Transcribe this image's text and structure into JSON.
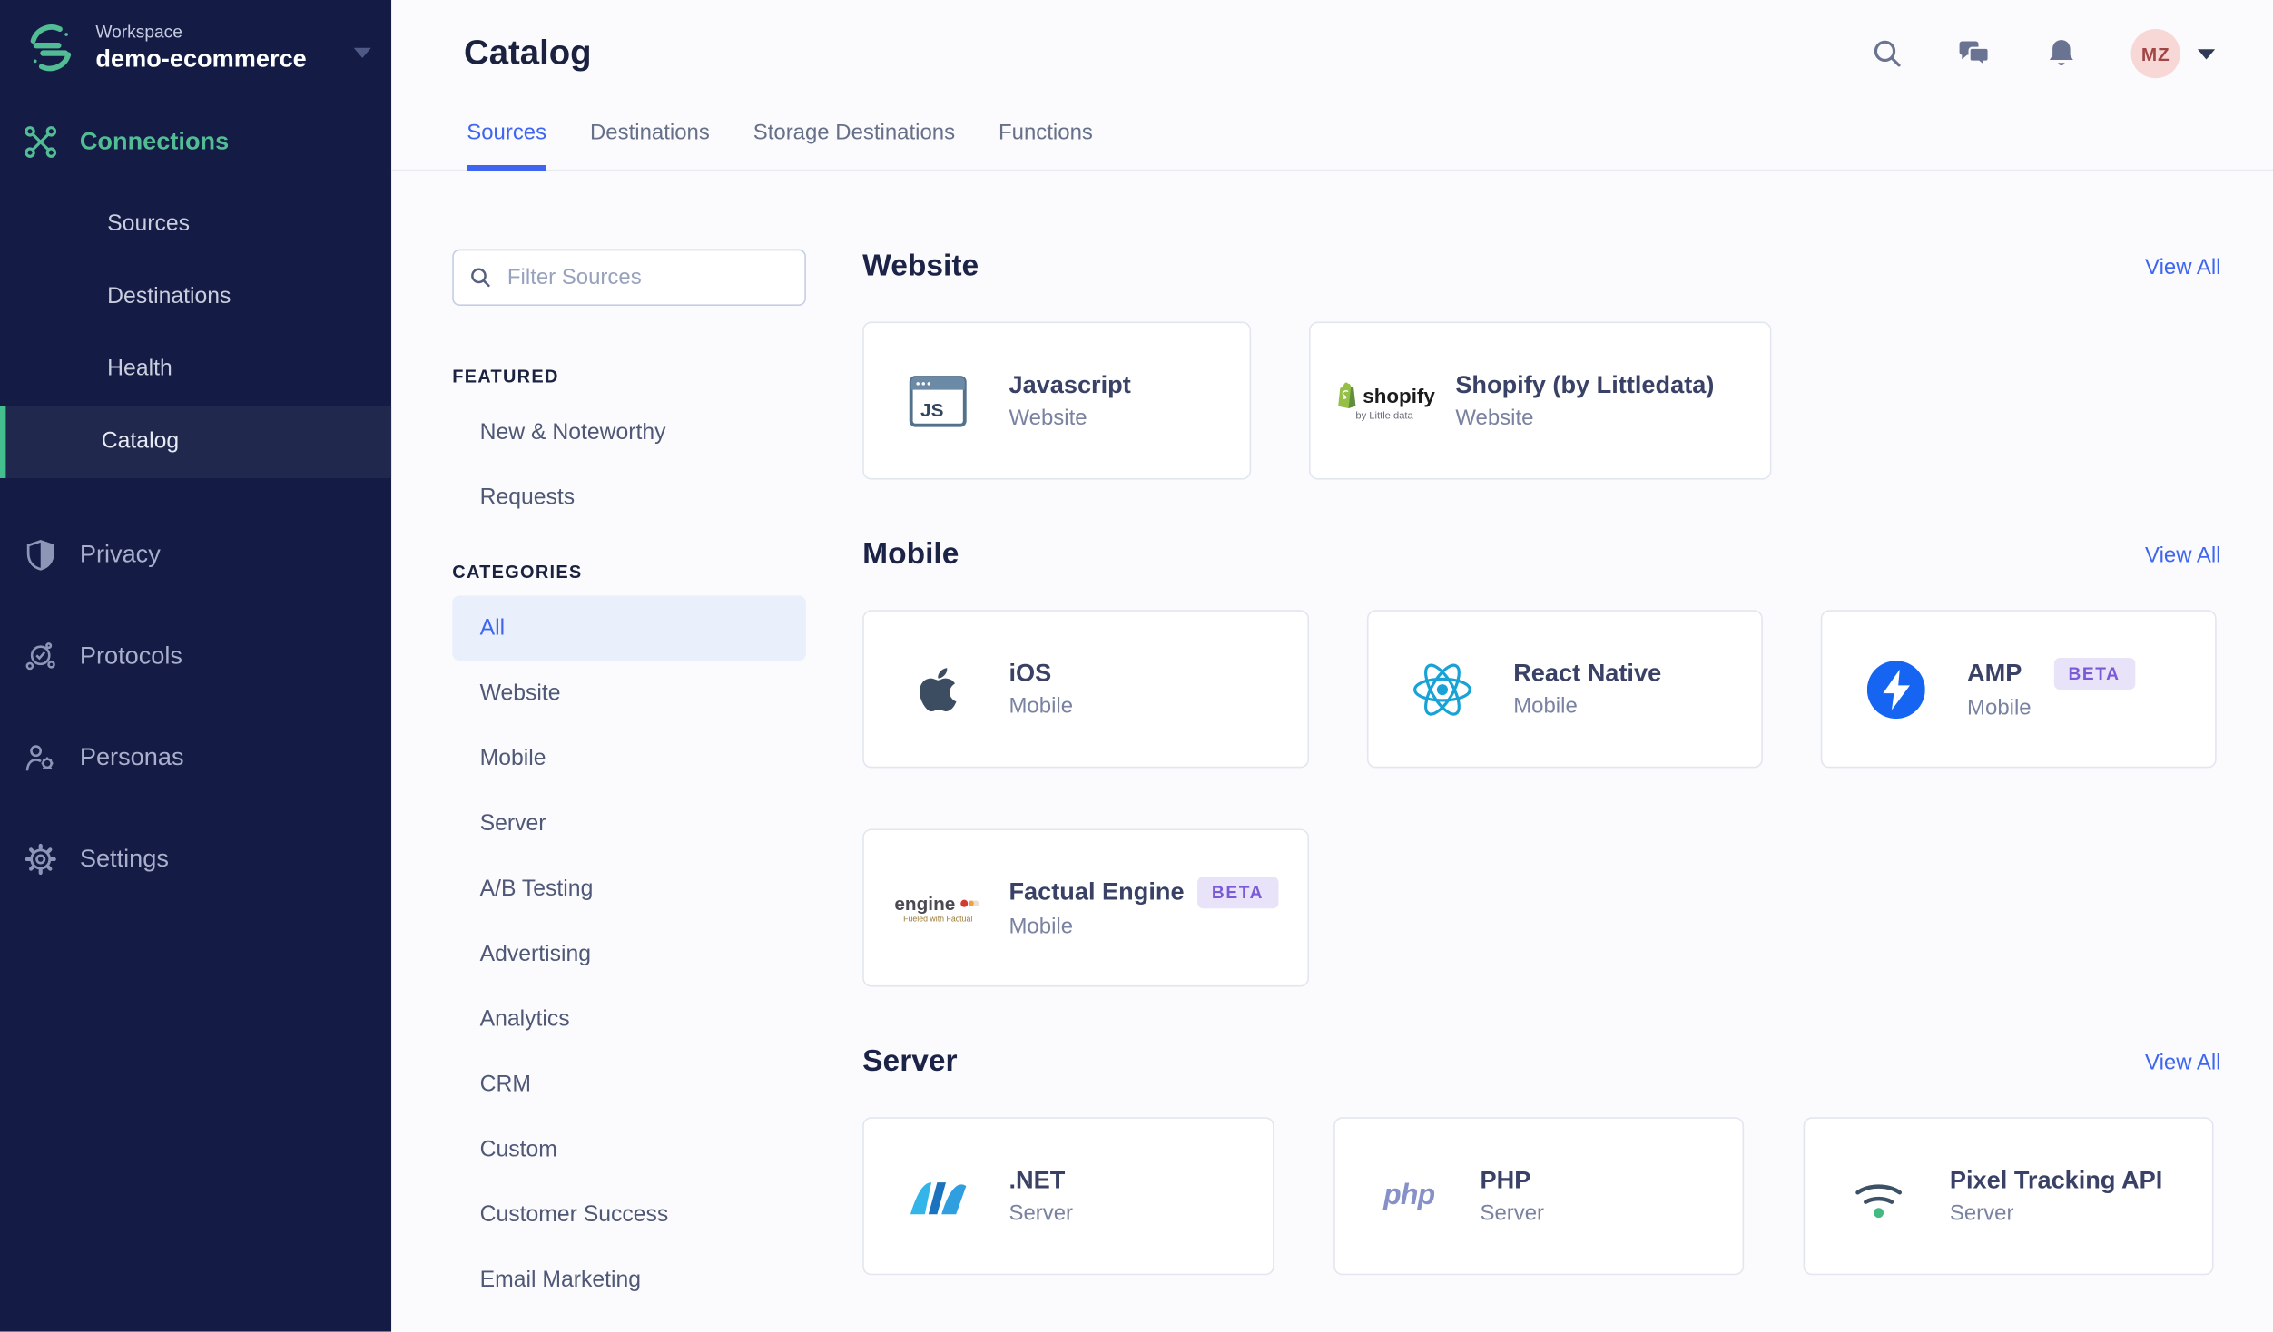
{
  "workspace": {
    "label": "Workspace",
    "name": "demo-ecommerce"
  },
  "sidebar": {
    "primary": {
      "label": "Connections",
      "items": [
        "Sources",
        "Destinations",
        "Health",
        "Catalog"
      ],
      "active_item": "Catalog"
    },
    "secondary": [
      "Privacy",
      "Protocols",
      "Personas",
      "Settings"
    ]
  },
  "header": {
    "title": "Catalog",
    "tabs": [
      "Sources",
      "Destinations",
      "Storage Destinations",
      "Functions"
    ],
    "active_tab": "Sources",
    "avatar_initials": "MZ"
  },
  "filter": {
    "placeholder": "Filter Sources"
  },
  "featured": {
    "heading": "FEATURED",
    "items": [
      "New & Noteworthy",
      "Requests"
    ]
  },
  "categories": {
    "heading": "CATEGORIES",
    "active": "All",
    "items": [
      "All",
      "Website",
      "Mobile",
      "Server",
      "A/B Testing",
      "Advertising",
      "Analytics",
      "CRM",
      "Custom",
      "Customer Success",
      "Email Marketing"
    ]
  },
  "sections": [
    {
      "title": "Website",
      "view_all": "View All",
      "cards": [
        {
          "name": "Javascript",
          "category": "Website",
          "icon": "javascript-browser-icon"
        },
        {
          "name": "Shopify (by Littledata)",
          "category": "Website",
          "icon": "shopify-icon"
        }
      ]
    },
    {
      "title": "Mobile",
      "view_all": "View All",
      "cards": [
        {
          "name": "iOS",
          "category": "Mobile",
          "icon": "apple-icon"
        },
        {
          "name": "React Native",
          "category": "Mobile",
          "icon": "react-icon"
        },
        {
          "name": "AMP",
          "category": "Mobile",
          "icon": "amp-icon",
          "badge": "BETA"
        },
        {
          "name": "Factual Engine",
          "category": "Mobile",
          "icon": "factual-engine-icon",
          "badge": "BETA"
        }
      ]
    },
    {
      "title": "Server",
      "view_all": "View All",
      "cards": [
        {
          "name": ".NET",
          "category": "Server",
          "icon": "dotnet-icon"
        },
        {
          "name": "PHP",
          "category": "Server",
          "icon": "php-icon"
        },
        {
          "name": "Pixel Tracking API",
          "category": "Server",
          "icon": "pixel-tracking-api-icon"
        }
      ]
    }
  ],
  "logos": {
    "javascript_glyph": "JS",
    "shopify_wordmark": "shopify",
    "shopify_caption": "by Little data",
    "factual_wordmark": "engine",
    "factual_caption": "Fueled with Factual",
    "php_wordmark": "php"
  },
  "colors": {
    "sidebar_bg": "#141b44",
    "accent_green": "#52bd95",
    "link_blue": "#3e66f0",
    "beta_badge_bg": "#e9e3f9",
    "beta_badge_text": "#7a5ad6",
    "avatar_bg": "#f7d8d6",
    "avatar_text": "#a14545"
  }
}
